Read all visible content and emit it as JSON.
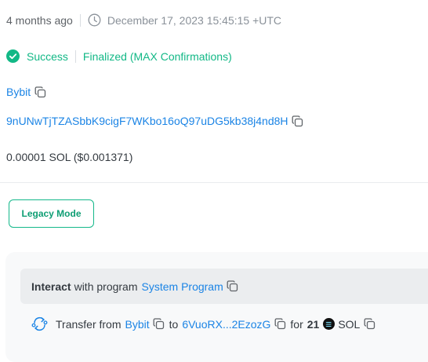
{
  "timestamp": {
    "relative": "4 months ago",
    "absolute": "December 17, 2023 15:45:15 +UTC"
  },
  "status": {
    "result": "Success",
    "confirmation": "Finalized (MAX Confirmations)"
  },
  "signer": {
    "label": "Bybit"
  },
  "signature": {
    "value": "9nUNwTjTZASbbK9cigF7WKbo16oQ97uDG5kb38j4nd8H"
  },
  "fee": {
    "text": "0.00001 SOL ($0.001371)"
  },
  "legacy_mode_button": "Legacy Mode",
  "instruction": {
    "interact_bold": "Interact",
    "with_text": "with program",
    "program": "System Program"
  },
  "transfer": {
    "prefix": "Transfer from",
    "from": "Bybit",
    "to_word": "to",
    "to": "6VuoRX...2EzozG",
    "for_word": "for",
    "amount": "21",
    "token": "SOL"
  },
  "colors": {
    "link": "#1b84e5",
    "success": "#12b886",
    "panel": "#f8f9fa"
  },
  "icons": [
    "clock-icon",
    "check-circle-icon",
    "copy-icon",
    "transfer-arrows-icon",
    "sol-token-icon"
  ]
}
